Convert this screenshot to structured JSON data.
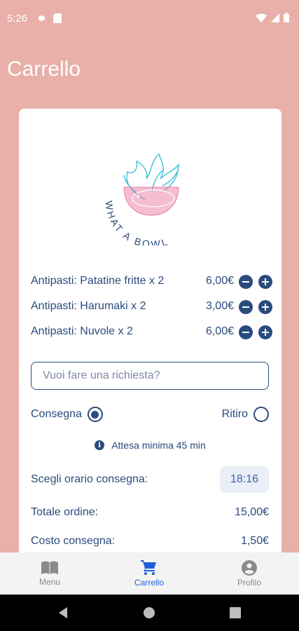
{
  "status_bar": {
    "time": "5:26"
  },
  "header": {
    "title": "Carrello"
  },
  "logo": {
    "text": "WHAT A BOWL"
  },
  "cart_items": [
    {
      "label": "Antipasti: Patatine fritte x 2",
      "price": "6,00€"
    },
    {
      "label": "Antipasti: Harumaki x 2",
      "price": "3,00€"
    },
    {
      "label": "Antipasti: Nuvole x 2",
      "price": "6,00€"
    }
  ],
  "request": {
    "placeholder": "Vuoi fare una richiesta?"
  },
  "delivery_options": {
    "consegna": "Consegna",
    "ritiro": "Ritiro",
    "selected": "Consegna"
  },
  "info": {
    "text": "Attesa minima 45 min"
  },
  "schedule": {
    "label": "Scegli orario consegna:",
    "time": "18:16"
  },
  "summary": {
    "total_label": "Totale ordine:",
    "total_value": "15,00€",
    "delivery_label": "Costo consegna:",
    "delivery_value": "1,50€"
  },
  "bottom_nav": {
    "menu": "Menu",
    "cart": "Carrello",
    "profile": "Profilo",
    "active": "Carrello"
  },
  "colors": {
    "background": "#e8b0a8",
    "primary": "#2a4b7d",
    "active_nav": "#1e5fd8",
    "logo_teal": "#3bc1d6",
    "logo_pink": "#ec7ca6"
  }
}
